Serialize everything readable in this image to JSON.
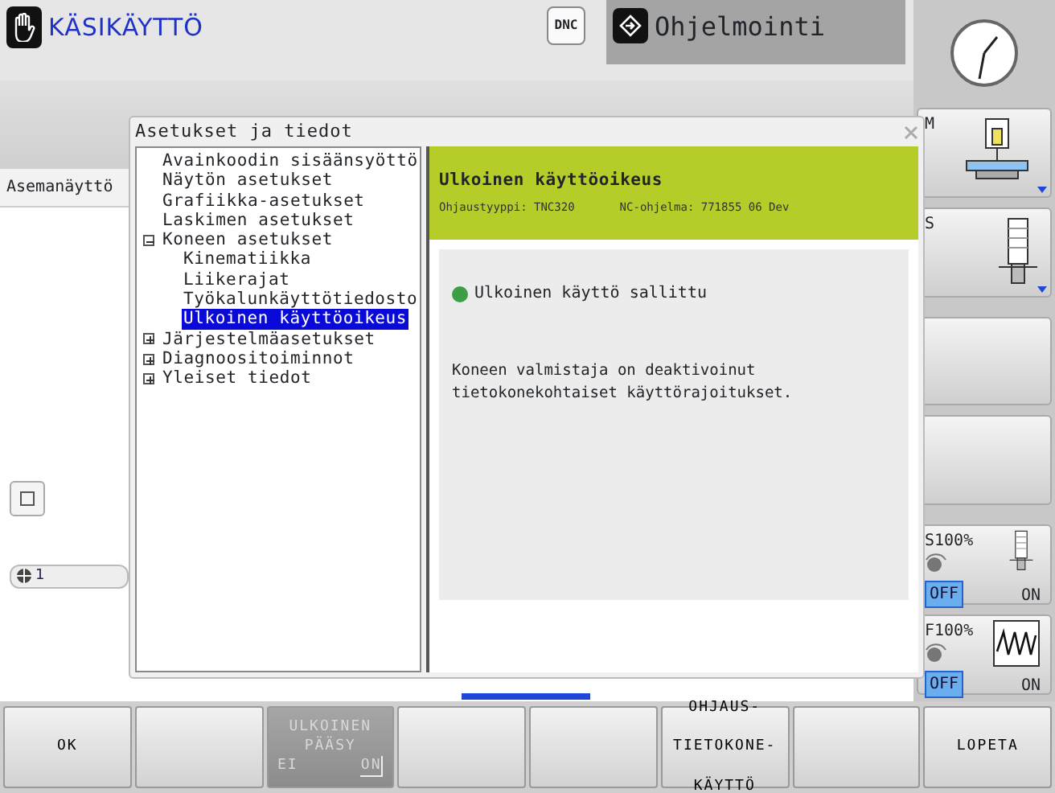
{
  "mode": {
    "title": "KÄSIKÄYTTÖ"
  },
  "dnc": {
    "label": "DNC"
  },
  "program_mode": {
    "title": "Ohjelmointi"
  },
  "left_panel": {
    "tab": "Asemanäyttö",
    "status": "1"
  },
  "dialog": {
    "title": "Asetukset ja tiedot",
    "tree": [
      {
        "label": "Avainkoodin sisäänsyöttö",
        "selected": false
      },
      {
        "label": "Näytön asetukset",
        "selected": false
      },
      {
        "label": "Grafiikka-asetukset",
        "selected": false
      },
      {
        "label": "Laskimen asetukset",
        "selected": false
      },
      {
        "label": "Koneen asetukset",
        "selected": false,
        "expanded": true,
        "children": [
          {
            "label": "Kinematiikka",
            "selected": false
          },
          {
            "label": "Liikerajat",
            "selected": false
          },
          {
            "label": "Työkalunkäyttötiedosto",
            "selected": false
          },
          {
            "label": "Ulkoinen käyttöoikeus",
            "selected": true
          }
        ]
      },
      {
        "label": "Järjestelmäasetukset",
        "selected": false,
        "expanded": false
      },
      {
        "label": "Diagnoositoiminnot",
        "selected": false,
        "expanded": false
      },
      {
        "label": "Yleiset tiedot",
        "selected": false,
        "expanded": false
      }
    ],
    "detail": {
      "heading": "Ulkoinen käyttöoikeus",
      "info": [
        "Ohjaustyyppi: TNC320",
        "NC-ohjelma: 771855 06 Dev"
      ],
      "status": {
        "text": "Ulkoinen käyttö sallittu",
        "color": "#3c9f45"
      },
      "message": "Koneen valmistaja on deaktivoinut tietokonekohtaiset käyttörajoitukset."
    }
  },
  "side_panel": [
    {
      "kind": "tool",
      "label": "M"
    },
    {
      "kind": "spindle",
      "label": "S"
    },
    {
      "kind": "blank"
    },
    {
      "kind": "blank"
    },
    {
      "kind": "spindle_override",
      "label": "S100%",
      "off": "OFF",
      "on": "ON",
      "switched_on": false
    },
    {
      "kind": "feed_override",
      "label": "F100%",
      "off": "OFF",
      "on": "ON",
      "switched_on": false
    }
  ],
  "softkeys": [
    {
      "kind": "text",
      "lines": [
        "OK"
      ]
    },
    {
      "kind": "blank"
    },
    {
      "kind": "switch",
      "lines": [
        "ULKOINEN",
        "PÄÄSY"
      ],
      "off": "EI",
      "on": "ON",
      "switched_on": true,
      "disabled": true
    },
    {
      "kind": "blank"
    },
    {
      "kind": "blank"
    },
    {
      "kind": "text",
      "lines": [
        "OHJAUS-",
        "TIETOKONE-",
        "KÄYTTÖ"
      ]
    },
    {
      "kind": "blank"
    },
    {
      "kind": "text",
      "lines": [
        "LOPETA"
      ]
    }
  ]
}
